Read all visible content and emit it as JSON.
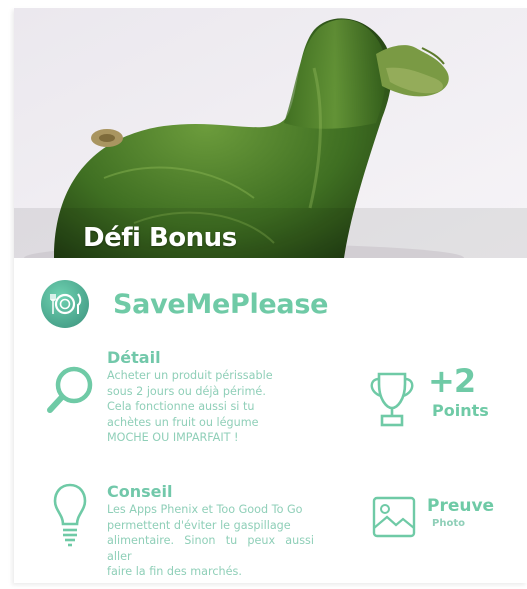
{
  "hero": {
    "title": "Défi Bonus",
    "image_subject": "duck-shaped zucchini photo"
  },
  "app": {
    "name": "SaveMePlease",
    "logo_icon": "plate-fork-knife-icon"
  },
  "detail": {
    "title": "Détail",
    "lines": [
      "Acheter un produit périssable",
      "sous 2 jours ou déjà périmé.",
      "Cela fonctionne aussi si tu",
      "achètes un fruit ou légume",
      "MOCHE OU IMPARFAIT !"
    ],
    "icon": "magnifier-icon"
  },
  "reward": {
    "value": "+2",
    "label": "Points",
    "icon": "trophy-icon"
  },
  "advice": {
    "title": "Conseil",
    "lines": [
      "Les Apps Phenix et Too Good To Go",
      "permettent d'éviter le gaspillage",
      "alimentaire. Sinon tu peux aussi aller",
      "faire la fin des marchés."
    ],
    "icon": "lightbulb-icon"
  },
  "proof": {
    "title": "Preuve",
    "type": "Photo",
    "icon": "photo-icon"
  },
  "colors": {
    "accent": "#6fcaa6",
    "accent_light": "#8fcfb8",
    "logo_bg": "#4aa48c"
  }
}
